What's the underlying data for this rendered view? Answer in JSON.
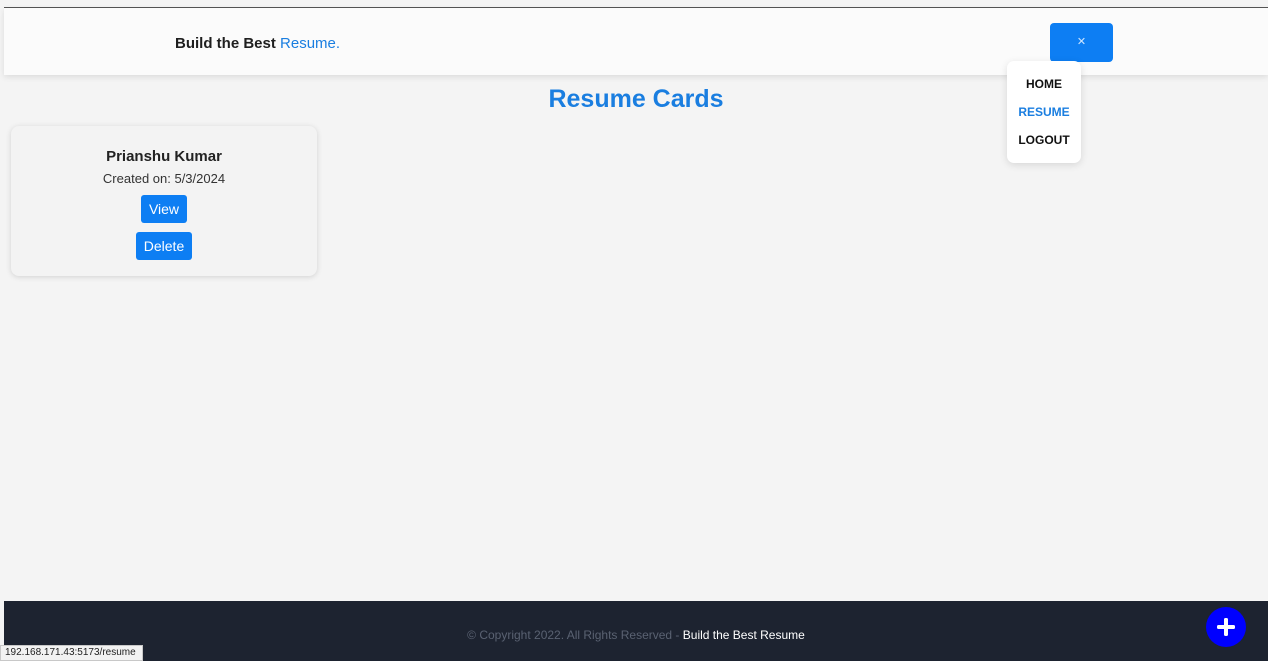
{
  "navbar": {
    "brand_text": "Build the Best ",
    "brand_accent": "Resume.",
    "menu_button_icon": "close-icon",
    "dropdown": [
      {
        "label": "HOME",
        "active": false
      },
      {
        "label": "RESUME",
        "active": true
      },
      {
        "label": "LOGOUT",
        "active": false
      }
    ]
  },
  "main": {
    "title": "Resume Cards",
    "cards": [
      {
        "name": "Prianshu Kumar",
        "created": "Created on: 5/3/2024",
        "view_label": "View",
        "delete_label": "Delete"
      }
    ]
  },
  "footer": {
    "copyright": "© Copyright 2022. All Rights Reserved - ",
    "brand": "Build the Best Resume"
  },
  "fab": {
    "icon": "plus-icon"
  },
  "status_bar": {
    "url": "192.168.171.43:5173/resume"
  },
  "colors": {
    "accent": "#1a7ee0",
    "button": "#0d7ef3",
    "footer_bg": "#1d2330",
    "fab": "#0000ff"
  }
}
